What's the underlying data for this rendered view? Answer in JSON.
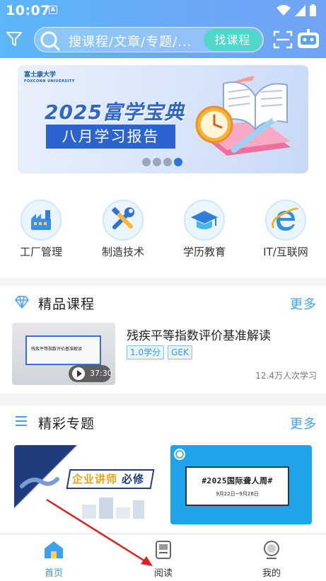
{
  "status_bar": {
    "time": "10:07",
    "app_icon_glyph": "A"
  },
  "search": {
    "placeholder": "搜课程/文章/专题/...",
    "button_label": "找课程"
  },
  "banner": {
    "logo_text": "富士康大学",
    "logo_subtext": "FOXCONN UNIVERSITY",
    "title": "2025富学宝典",
    "subtitle": "八月学习报告",
    "dots": 4,
    "active_dot": 4
  },
  "categories": [
    {
      "label": "工厂管理",
      "icon": "factory-icon"
    },
    {
      "label": "制造技术",
      "icon": "tools-icon"
    },
    {
      "label": "学历教育",
      "icon": "graduation-cap-icon"
    },
    {
      "label": "IT/互联网",
      "icon": "internet-explorer-icon"
    }
  ],
  "premium_courses": {
    "title": "精品课程",
    "more": "更多",
    "course": {
      "name": "残疾平等指数评价基准解读",
      "thumb_text": "残疾平等指数评价基准解读",
      "duration": "37:30",
      "tags": [
        "1.0学分",
        "GEK"
      ],
      "learners": "12.4万人次学习"
    }
  },
  "topics": {
    "title": "精彩专题",
    "more": "更多",
    "items": [
      {
        "ribbon": "企业讲师",
        "badge": "必修"
      },
      {
        "title": "#2025国际聋人周#",
        "date": "9月22日~9月28日"
      }
    ]
  },
  "bottom_nav": {
    "items": [
      {
        "label": "首页",
        "icon": "home-icon",
        "active": true
      },
      {
        "label": "阅读",
        "icon": "book-icon",
        "active": false
      },
      {
        "label": "我的",
        "icon": "profile-icon",
        "active": false
      }
    ]
  },
  "colors": {
    "header": "#69a9f6",
    "accent": "#3aa5f2",
    "search_button": "#4fd8c9",
    "annotation_arrow": "#e02020"
  }
}
